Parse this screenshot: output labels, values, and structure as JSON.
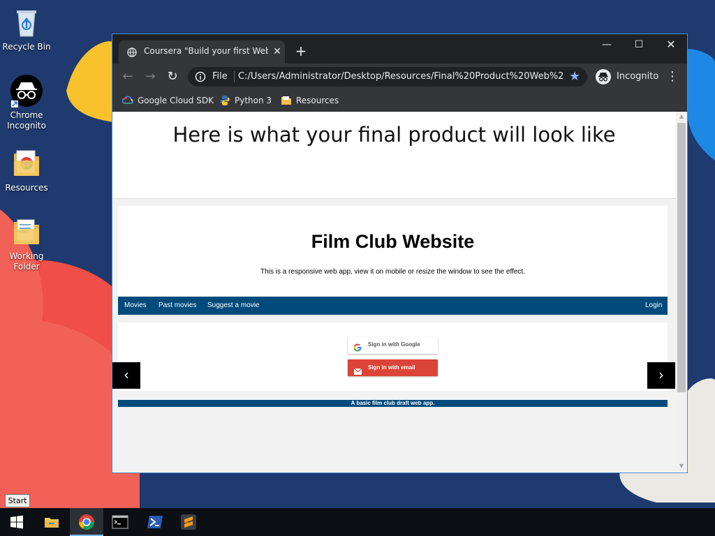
{
  "desktop": {
    "icons": [
      {
        "label": "Recycle Bin",
        "icon": "recycle-bin-icon"
      },
      {
        "label": "Chrome Incognito",
        "icon": "chrome-incognito-icon"
      },
      {
        "label": "Resources",
        "icon": "folder-chrome-icon"
      },
      {
        "label": "Working Folder",
        "icon": "folder-icon"
      }
    ]
  },
  "browser": {
    "tab_title": "Coursera \"Build your first Web App\"",
    "address_scheme": "File",
    "url": "C:/Users/Administrator/Desktop/Resources/Final%20Product%20Web%2...",
    "profile_label": "Incognito",
    "bookmarks": [
      {
        "label": "Google Cloud SDK",
        "icon": "google-cloud-icon"
      },
      {
        "label": "Python 3",
        "icon": "python-icon"
      },
      {
        "label": "Resources",
        "icon": "folder-icon"
      }
    ]
  },
  "page": {
    "headline": "Here is what your final product will look like",
    "site_title": "Film Club Website",
    "site_subtitle": "This is a responsive web app, view it on mobile or resize the window to see the effect.",
    "nav": {
      "movies": "Movies",
      "past_movies": "Past movies",
      "suggest": "Suggest a movie",
      "login": "Login"
    },
    "google_signin": "Sign in with Google",
    "email_signin": "Sign in with email",
    "prev_arrow": "‹",
    "next_arrow": "›",
    "footer": "A basic film club draft web app."
  },
  "taskbar": {
    "start_tooltip": "Start",
    "items": [
      "start-icon",
      "file-explorer-icon",
      "chrome-icon",
      "command-prompt-icon",
      "powershell-icon",
      "sublime-text-icon"
    ]
  },
  "colors": {
    "nav_blue": "#004a7c",
    "email_red": "#db4437",
    "chrome_dark": "#202124",
    "chrome_toolbar": "#35363a"
  }
}
